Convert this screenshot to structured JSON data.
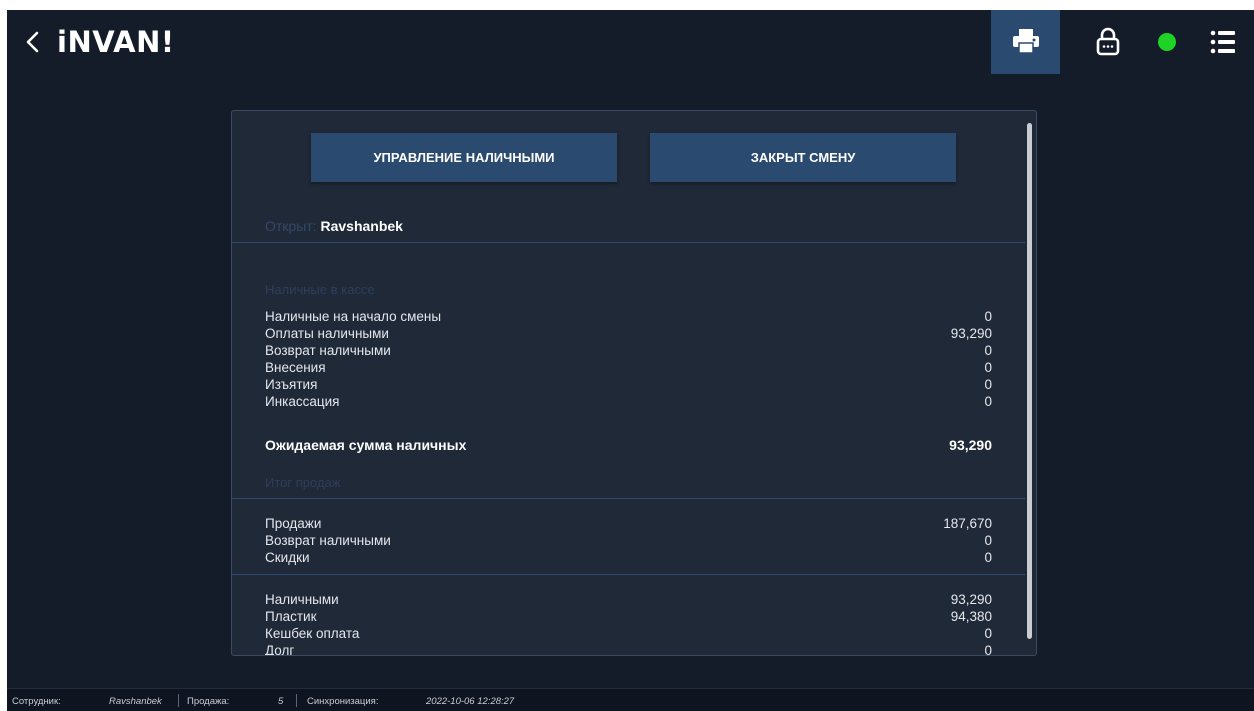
{
  "header": {
    "logo_text": "iNVAN!",
    "back_icon": "chevron-left-icon",
    "print_icon": "printer-icon",
    "lock_icon": "lock-icon",
    "menu_icon": "list-icon",
    "status_color": "#1ed325",
    "accent_color": "#2b4a70"
  },
  "panel": {
    "cash_management_label": "УПРАВЛЕНИЕ НАЛИЧНЫМИ",
    "close_shift_label": "ЗАКРЫТ СМЕНУ",
    "opened_label": "Открыт:",
    "opened_user": "Ravshanbek",
    "cash_section": {
      "title": "Наличные в кассе",
      "rows": [
        {
          "label": "Наличные на начало смены",
          "value": "0"
        },
        {
          "label": "Оплаты наличными",
          "value": "93,290"
        },
        {
          "label": "Возврат наличными",
          "value": "0"
        },
        {
          "label": "Внесения",
          "value": "0"
        },
        {
          "label": "Изъятия",
          "value": "0"
        },
        {
          "label": "Инкассация",
          "value": "0"
        }
      ],
      "expected_label": "Ожидаемая сумма наличных",
      "expected_value": "93,290"
    },
    "sales_section": {
      "title": "Итог продаж",
      "rows": [
        {
          "label": "Продажи",
          "value": "187,670"
        },
        {
          "label": "Возврат наличными",
          "value": "0"
        },
        {
          "label": "Скидки",
          "value": "0"
        }
      ]
    },
    "payments": {
      "rows": [
        {
          "label": "Наличными",
          "value": "93,290"
        },
        {
          "label": "Пластик",
          "value": "94,380"
        },
        {
          "label": "Кешбек оплата",
          "value": "0"
        },
        {
          "label": "Долг",
          "value": "0"
        }
      ]
    }
  },
  "statusbar": {
    "employee_label": "Сотрудник:",
    "employee_value": "Ravshanbek",
    "sale_label": "Продажа:",
    "sale_value": "5",
    "sync_label": "Синхронизация:",
    "sync_value": "2022-10-06 12:28:27"
  }
}
